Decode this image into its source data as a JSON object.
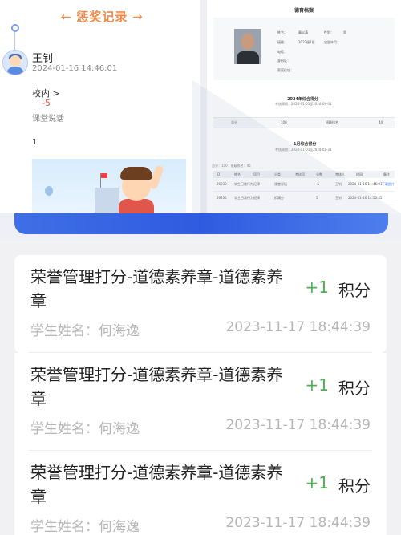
{
  "award": {
    "title": "惩奖记录",
    "name": "王钊",
    "time": "2024-01-16 14:46:01",
    "section": "校内 >",
    "score": "-5",
    "classroom": "课堂说话",
    "count": "1"
  },
  "doc": {
    "title": "德育档案",
    "profile": {
      "name_label": "姓名：",
      "name_value": "章义清",
      "gender_label": "性别：",
      "gender_value": "男",
      "class_label": "班级：",
      "class_value": "2022级1班",
      "birth_label": "出生年月：",
      "phone_label": "电话：",
      "id_label": "身份证：",
      "home_label": "家庭住址："
    },
    "year_title": "2024年综合得分",
    "year_range": "考核周期：2024-01-01至2024-04-01",
    "summary": {
      "total_label": "总分",
      "total_value": "100",
      "rank_label": "班级排名",
      "rank_value": "44"
    },
    "month_title": "1月综合得分",
    "month_range": "考核周期：2024-01-01至2024-01-31",
    "month_score": "总分：100　班级排名：45",
    "table": {
      "headers": [
        "ID",
        "姓名",
        "项目",
        "分类",
        "考核项",
        "分数",
        "考核人",
        "时间",
        "备注"
      ],
      "rows": [
        {
          "id": "26230",
          "name": "学生日常行为",
          "item": "纪律",
          "cat": "课堂说话",
          "score": "-5",
          "by": "王钊",
          "time": "2024-01-16 14:46:01",
          "note": "下载图片"
        },
        {
          "id": "26235",
          "name": "学生日常行为",
          "item": "纪律",
          "cat": "扣满分",
          "score": "5",
          "by": "王钊",
          "time": "2024-01-16 14:50:45",
          "note": ""
        }
      ]
    }
  },
  "records": [
    {
      "title": "荣誉管理打分-道德素养章-道德素养章",
      "points": "+1",
      "unit": "积分",
      "student": "学生姓名：何海逸",
      "time": "2023-11-17 18:44:39"
    },
    {
      "title": "荣誉管理打分-道德素养章-道德素养章",
      "points": "+1",
      "unit": "积分",
      "student": "学生姓名：何海逸",
      "time": "2023-11-17 18:44:39"
    },
    {
      "title": "荣誉管理打分-道德素养章-道德素养章",
      "points": "+1",
      "unit": "积分",
      "student": "学生姓名：何海逸",
      "time": "2023-11-17 18:44:39"
    }
  ],
  "colors": {
    "accent": "#f08a4b",
    "positive": "#4caf50",
    "negative": "#e5533c",
    "brand": "#2f5be0"
  }
}
